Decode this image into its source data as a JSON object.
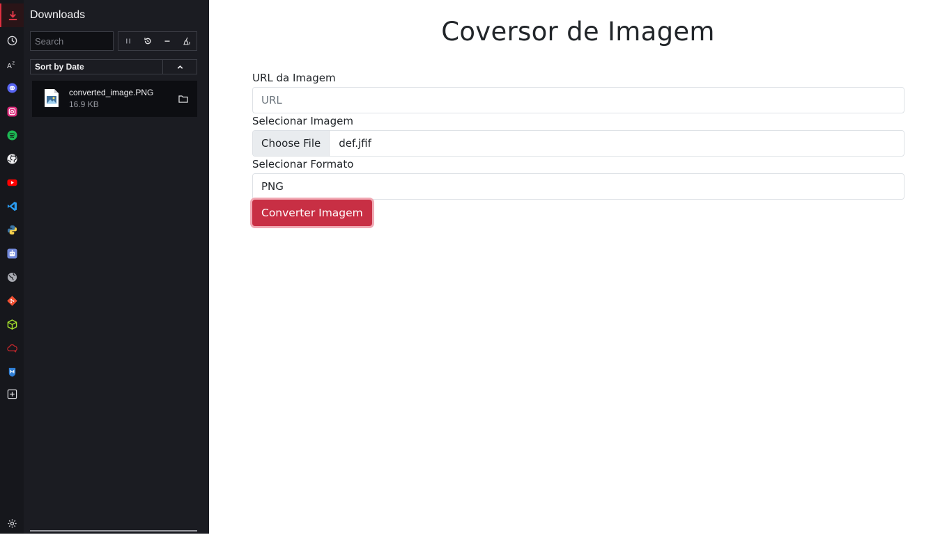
{
  "downloads_panel": {
    "title": "Downloads",
    "search_placeholder": "Search",
    "sort_label": "Sort by Date",
    "items": [
      {
        "name": "converted_image.PNG",
        "size": "16.9 KB"
      }
    ]
  },
  "rail_icons": [
    "download-icon",
    "history-icon",
    "translate-icon",
    "discord-icon",
    "instagram-icon",
    "spotify-icon",
    "github-icon",
    "youtube-icon",
    "vscode-icon",
    "python-icon",
    "bot-icon",
    "globe-icon",
    "git-icon",
    "package-icon",
    "cloud-icon",
    "malwarebytes-icon",
    "add-panel-icon",
    "settings-icon"
  ],
  "page": {
    "title": "Coversor de Imagem",
    "url_label": "URL da Imagem",
    "url_placeholder": "URL",
    "file_label": "Selecionar Imagem",
    "file_button": "Choose File",
    "file_name": "def.jfif",
    "format_label": "Selecionar Formato",
    "format_value": "PNG",
    "convert_button": "Converter Imagem"
  },
  "colors": {
    "accent": "#c82f44",
    "sidebar_bg": "#1b1c22",
    "rail_bg": "#16171c"
  }
}
